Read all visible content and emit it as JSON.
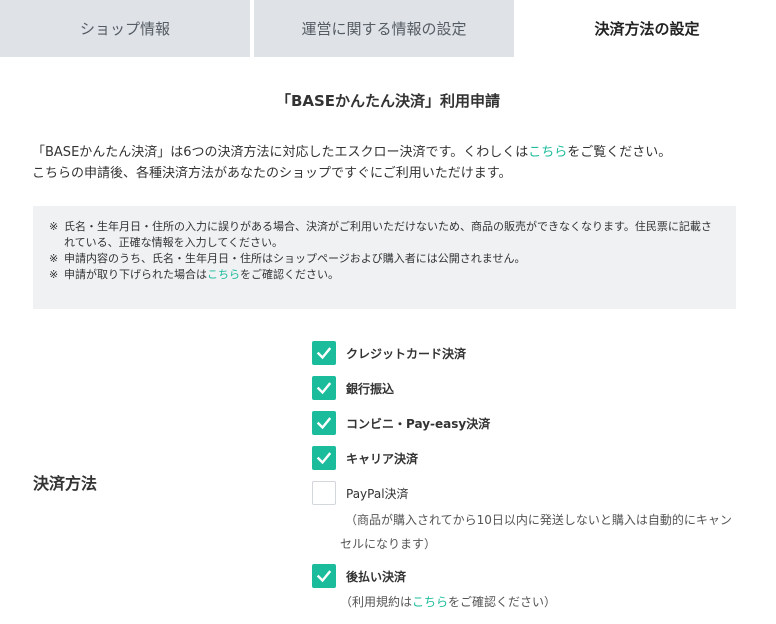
{
  "tabs": [
    {
      "label": "ショップ情報"
    },
    {
      "label": "運営に関する情報の設定"
    },
    {
      "label": "決済方法の設定"
    }
  ],
  "title": "「BASEかんたん決済」利用申請",
  "intro": {
    "line1_before": "「BASEかんたん決済」は6つの決済方法に対応したエスクロー決済です。くわしくは",
    "line1_link": "こちら",
    "line1_after": "をご覧ください。",
    "line2": "こちらの申請後、各種決済方法があなたのショップですぐにご利用いただけます。"
  },
  "notice": {
    "mark": "※",
    "item1": "氏名・生年月日・住所の入力に誤りがある場合、決済がご利用いただけないため、商品の販売ができなくなります。住民票に記載されている、正確な情報を入力してください。",
    "item2": "申請内容のうち、氏名・生年月日・住所はショップページおよび購入者には公開されません。",
    "item3_before": "申請が取り下げられた場合は",
    "item3_link": "こちら",
    "item3_after": "をご確認ください。"
  },
  "payment": {
    "label": "決済方法",
    "options": [
      {
        "label": "クレジットカード決済",
        "checked": true
      },
      {
        "label": "銀行振込",
        "checked": true
      },
      {
        "label": "コンビニ・Pay-easy決済",
        "checked": true
      },
      {
        "label": "キャリア決済",
        "checked": true
      },
      {
        "label": "PayPal決済",
        "checked": false
      },
      {
        "label": "後払い決済",
        "checked": true
      }
    ],
    "paypal_note_line1": "（商品が購入されてから10日以内に発送しないと購入は自動的にキャン",
    "paypal_note_line2": "セルになります）",
    "atobarai_note_before": "（利用規約は",
    "atobarai_note_link": "こちら",
    "atobarai_note_after": "をご確認ください）"
  },
  "colors": {
    "accent": "#1abc9c",
    "tab_inactive_bg": "#dfe3e8",
    "notice_bg": "#eff1f3"
  }
}
